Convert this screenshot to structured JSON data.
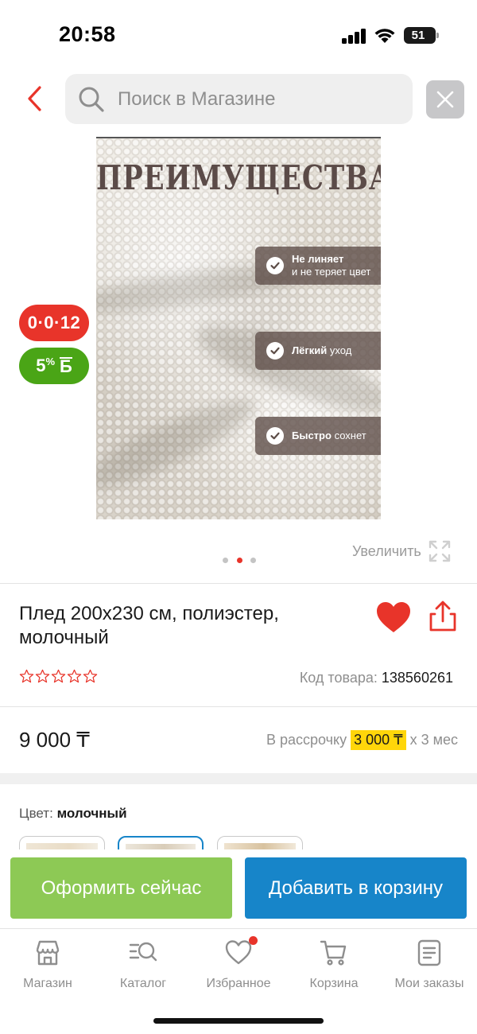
{
  "status_bar": {
    "time": "20:58",
    "battery": "51"
  },
  "search": {
    "placeholder": "Поиск в Магазине"
  },
  "product_image": {
    "title": "ПРЕИМУЩЕСТВА",
    "features": [
      {
        "bold": "Не линяет",
        "normal": "и не теряет цвет"
      },
      {
        "bold": "Лёгкий",
        "normal": "уход"
      },
      {
        "bold": "Быстро",
        "normal": "сохнет"
      }
    ]
  },
  "promo_badges": {
    "installment": "0·0·12",
    "bonus_percent": "5",
    "bonus_percent_sign": "%",
    "bonus_letter": "Б"
  },
  "carousel": {
    "count": 3,
    "active_index": 1,
    "zoom_label": "Увеличить"
  },
  "product": {
    "title": "Плед 200x230 см, полиэстер, молочный",
    "rating_stars": 0,
    "sku_label": "Код товара:",
    "sku_value": "138560261",
    "price": "9 000 ₸",
    "installment_prefix": "В рассрочку",
    "installment_amount": "3 000 ₸",
    "installment_suffix": "x 3 мес",
    "favorite": true
  },
  "color": {
    "label": "Цвет:",
    "value": "молочный",
    "selected_index": 1
  },
  "actions": {
    "buy_now": "Оформить сейчас",
    "add_to_cart": "Добавить в корзину"
  },
  "tabs": [
    {
      "label": "Магазин",
      "icon": "store-icon"
    },
    {
      "label": "Каталог",
      "icon": "catalog-search-icon"
    },
    {
      "label": "Избранное",
      "icon": "heart-icon",
      "has_notification": true
    },
    {
      "label": "Корзина",
      "icon": "cart-icon"
    },
    {
      "label": "Мои заказы",
      "icon": "orders-icon"
    }
  ],
  "colors": {
    "accent_red": "#e8342a",
    "accent_blue": "#1785c9",
    "accent_green": "#8dc955",
    "bonus_green": "#4aa516",
    "highlight_yellow": "#ffd60a"
  }
}
